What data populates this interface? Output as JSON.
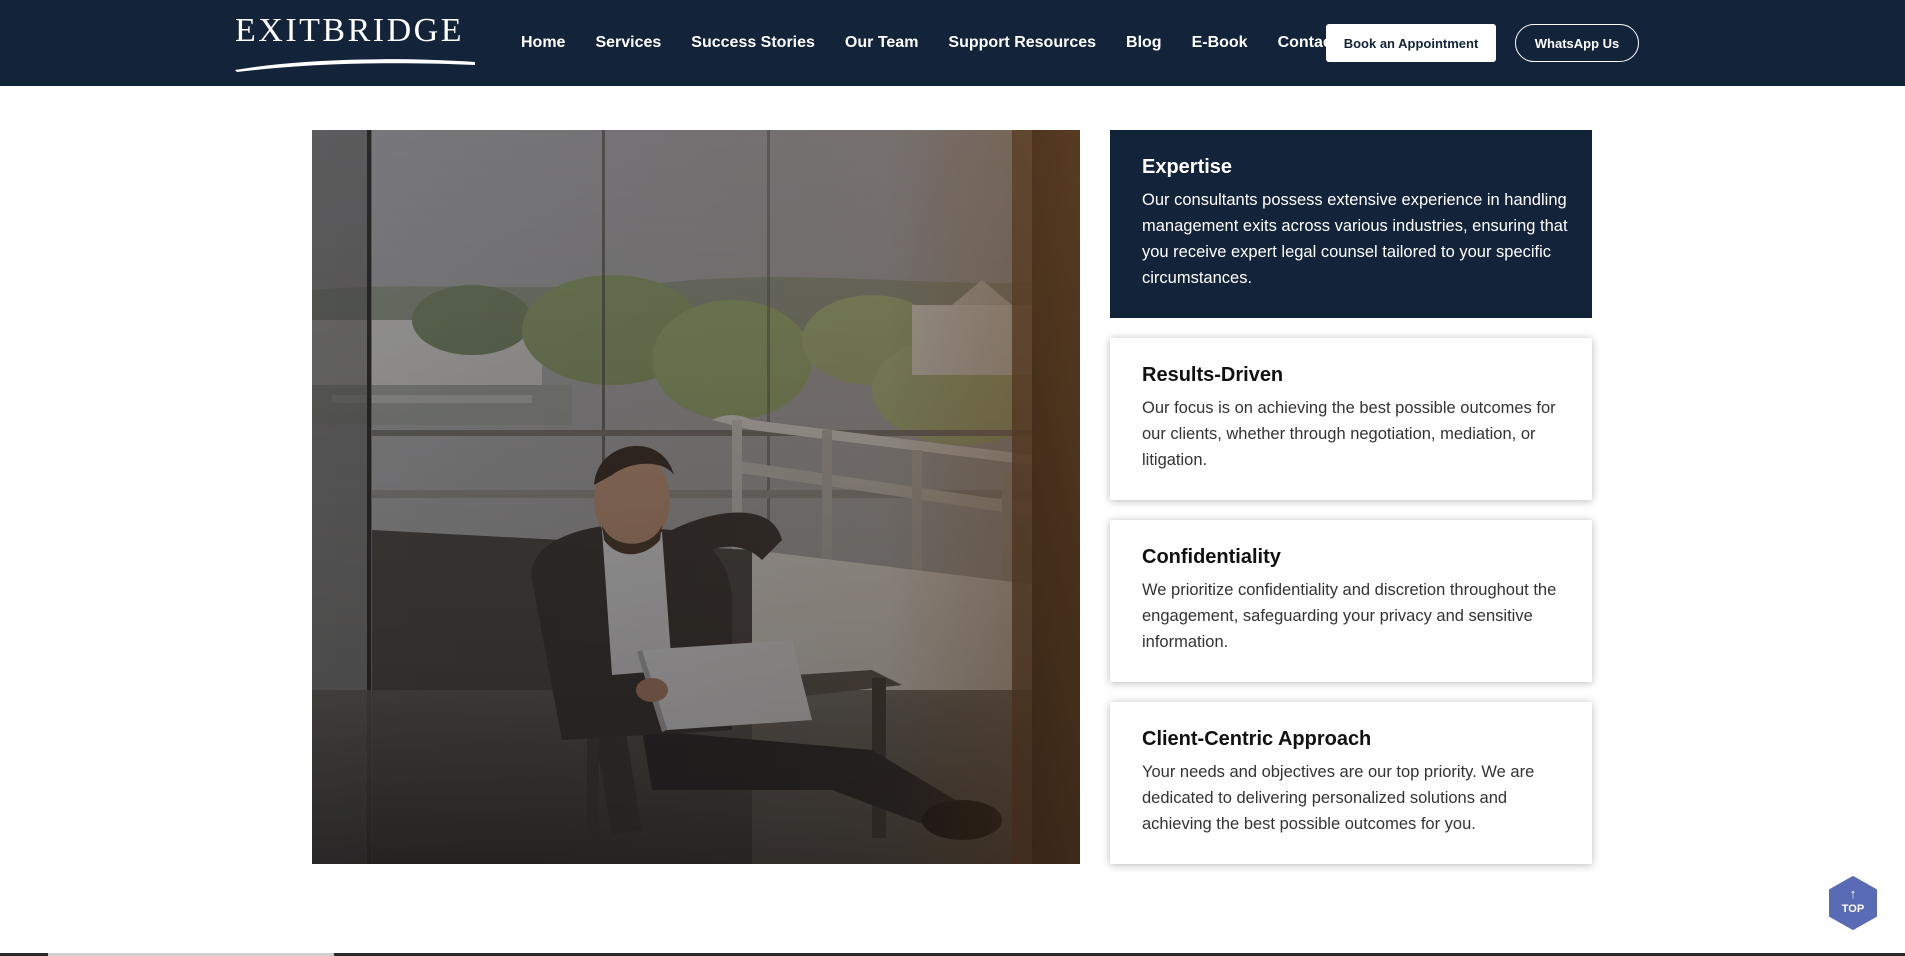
{
  "brand": {
    "logo_text": "EXITBRIDGE"
  },
  "nav": {
    "items": [
      {
        "label": "Home"
      },
      {
        "label": "Services"
      },
      {
        "label": "Success Stories"
      },
      {
        "label": "Our Team"
      },
      {
        "label": "Support Resources"
      },
      {
        "label": "Blog"
      },
      {
        "label": "E-Book"
      },
      {
        "label": "Contact Us"
      }
    ]
  },
  "header": {
    "book_label": "Book an Appointment",
    "whatsapp_label": "WhatsApp Us"
  },
  "features": [
    {
      "title": "Expertise",
      "text": "Our consultants possess extensive experience in handling management exits across various industries, ensuring that you receive expert legal counsel tailored to your specific circumstances."
    },
    {
      "title": "Results-Driven",
      "text": "Our focus is on achieving the best possible outcomes for our clients, whether through negotiation, mediation, or litigation."
    },
    {
      "title": "Confidentiality",
      "text": "We prioritize confidentiality and discretion throughout the engagement, safeguarding your privacy and sensitive information."
    },
    {
      "title": "Client-Centric Approach",
      "text": "Your needs and objectives are our top priority. We are dedicated to delivering personalized solutions and achieving the best possible outcomes for you."
    }
  ],
  "back_to_top": {
    "arrow": "↑",
    "label": "TOP"
  },
  "colors": {
    "navy": "#13233a",
    "top_button": "#5a6bb5"
  }
}
